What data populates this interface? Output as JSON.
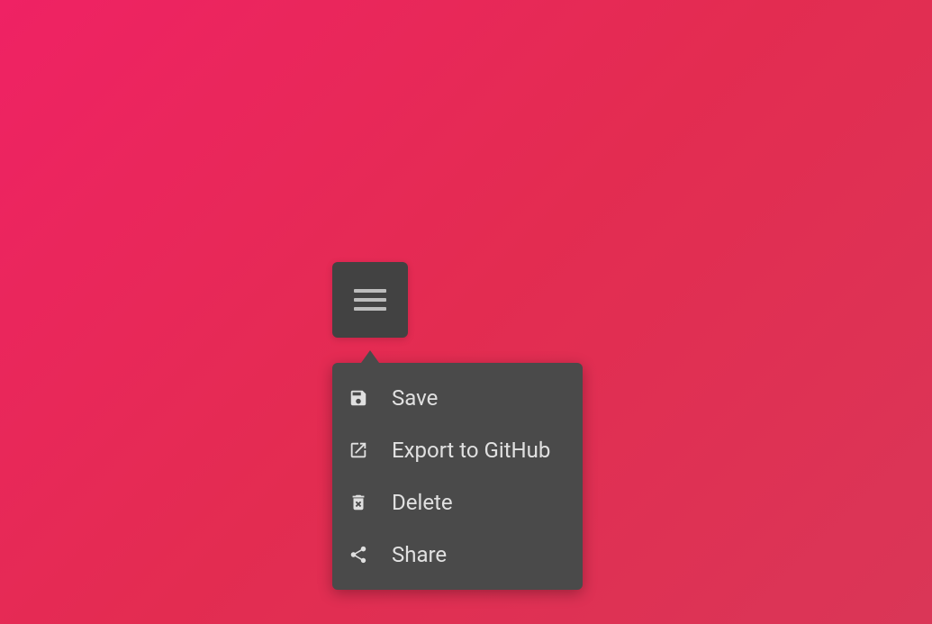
{
  "menu": {
    "items": [
      {
        "icon": "save-icon",
        "label": "Save"
      },
      {
        "icon": "export-icon",
        "label": "Export to GitHub"
      },
      {
        "icon": "delete-icon",
        "label": "Delete"
      },
      {
        "icon": "share-icon",
        "label": "Share"
      }
    ]
  }
}
